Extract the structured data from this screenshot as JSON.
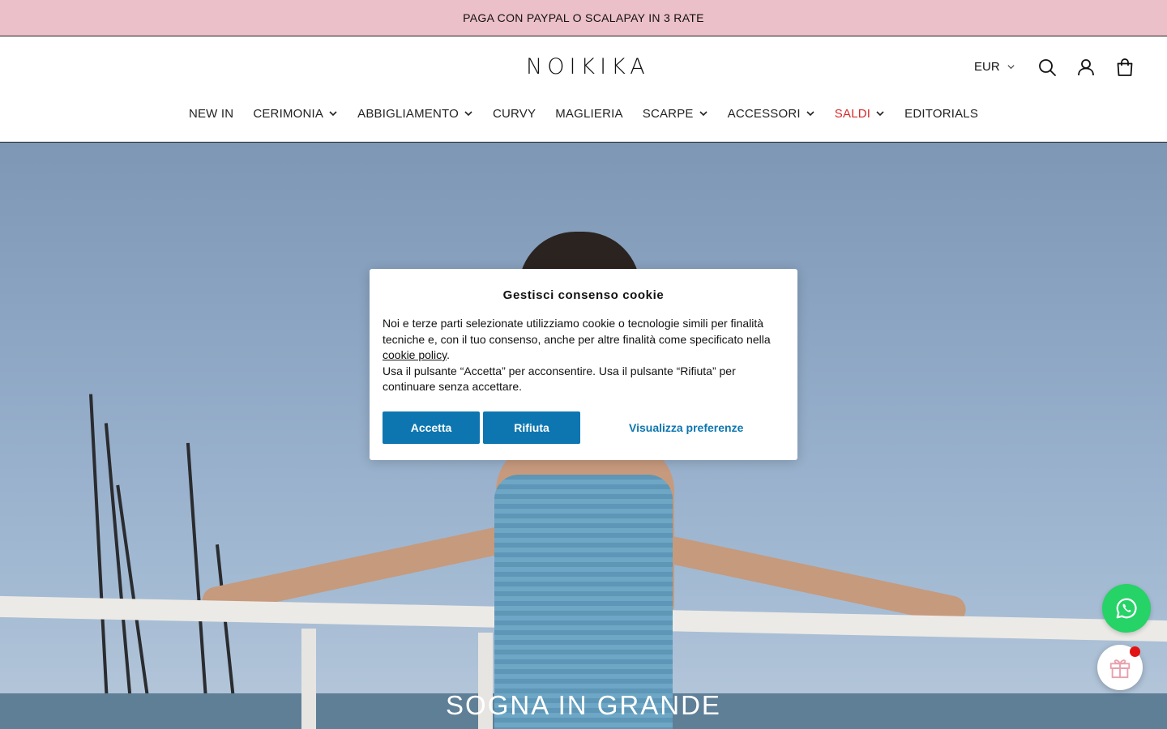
{
  "announcement": {
    "text": "PAGA CON PAYPAL O SCALAPAY IN 3 RATE"
  },
  "header": {
    "logo_text": "NOIKIKA",
    "currency": "EUR",
    "icons": [
      "search-icon",
      "account-icon",
      "cart-icon"
    ]
  },
  "nav": {
    "items": [
      {
        "label": "NEW IN",
        "dropdown": false
      },
      {
        "label": "CERIMONIA",
        "dropdown": true
      },
      {
        "label": "ABBIGLIAMENTO",
        "dropdown": true
      },
      {
        "label": "CURVY",
        "dropdown": false
      },
      {
        "label": "MAGLIERIA",
        "dropdown": false
      },
      {
        "label": "SCARPE",
        "dropdown": true
      },
      {
        "label": "ACCESSORI",
        "dropdown": true
      },
      {
        "label": "SALDI",
        "dropdown": true,
        "color": "#d62b2b"
      },
      {
        "label": "EDITORIALS",
        "dropdown": false
      }
    ]
  },
  "hero": {
    "title": "SOGNA IN GRANDE"
  },
  "cookie": {
    "title": "Gestisci consenso cookie",
    "body_part1": "Noi e terze parti selezionate utilizziamo cookie o tecnologie simili per finalità tecniche e, con il tuo consenso, anche per altre finalità come specificato nella ",
    "policy_link": "cookie policy",
    "body_part2": ".",
    "body_line2": "Usa il pulsante “Accetta” per acconsentire. Usa il pulsante “Rifiuta” per continuare senza accettare.",
    "accept": "Accetta",
    "reject": "Rifiuta",
    "preferences": "Visualizza preferenze",
    "accent_color": "#0d76b0"
  },
  "floating": {
    "icons": [
      "whatsapp-icon",
      "gift-icon"
    ]
  }
}
